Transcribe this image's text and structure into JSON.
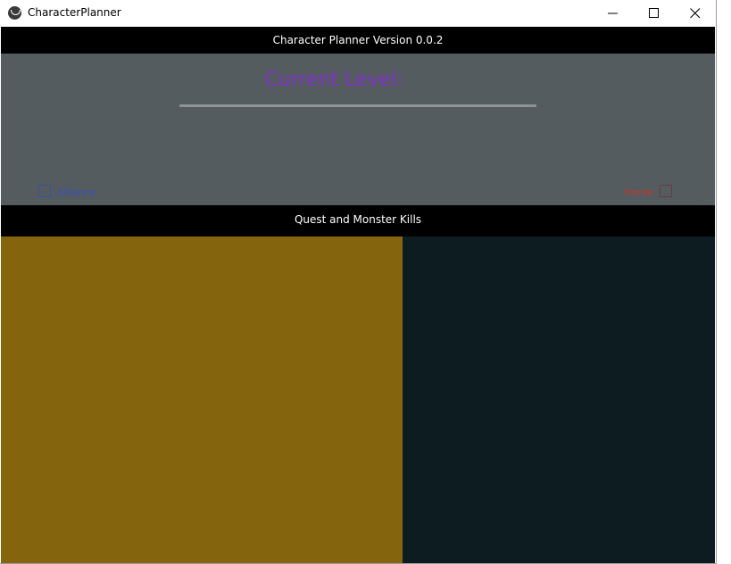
{
  "window": {
    "title": "CharacterPlanner",
    "controls": [
      "minimize-icon",
      "maximize-icon",
      "close-icon"
    ]
  },
  "header": {
    "title": "Character Planner Version 0.0.2"
  },
  "level_panel": {
    "current_level_label": "Current Level:",
    "slider_value": 0,
    "label_color": "#8032c8"
  },
  "factions": {
    "alliance": {
      "label": "Alliance",
      "checked": false,
      "color": "#3b4cc0"
    },
    "horde": {
      "label": "Horde",
      "checked": false,
      "color": "#c0392b"
    }
  },
  "section": {
    "title": "Quest and Monster Kills"
  },
  "colors": {
    "panel_bg": "#545c5f",
    "left_pane": "#84650d",
    "right_pane": "#0d1c21",
    "bar_bg": "#000000"
  }
}
